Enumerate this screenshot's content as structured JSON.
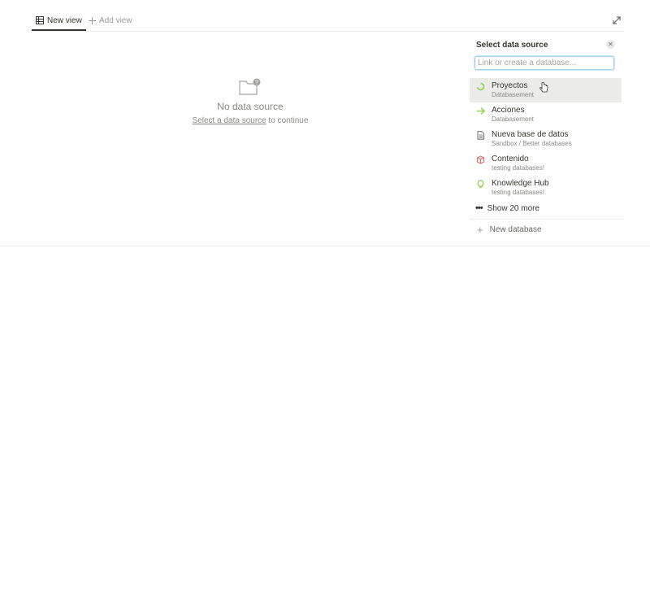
{
  "tabs": {
    "active_label": "New view",
    "add_label": "Add view"
  },
  "empty_state": {
    "title": "No data source",
    "link": "Select a data source",
    "suffix": " to continue"
  },
  "picker": {
    "title": "Select data source",
    "search_placeholder": "Link or create a database...",
    "items": [
      {
        "name": "Proyectos",
        "path": "Databasement",
        "icon": "spinner-icon",
        "color": "#8fd14f"
      },
      {
        "name": "Acciones",
        "path": "Databasement",
        "icon": "arrow-right-icon",
        "color": "#8fd14f"
      },
      {
        "name": "Nueva base de datos",
        "path": "Sandbox / Better databases",
        "icon": "page-icon",
        "color": "#6b6a66"
      },
      {
        "name": "Contenido",
        "path": "testing databases!",
        "icon": "box-icon",
        "color": "#e8716f"
      },
      {
        "name": "Knowledge Hub",
        "path": "testing databases!",
        "icon": "bulb-icon",
        "color": "#8fd14f"
      }
    ],
    "show_more_label": "Show 20 more",
    "new_database_label": "New database"
  }
}
